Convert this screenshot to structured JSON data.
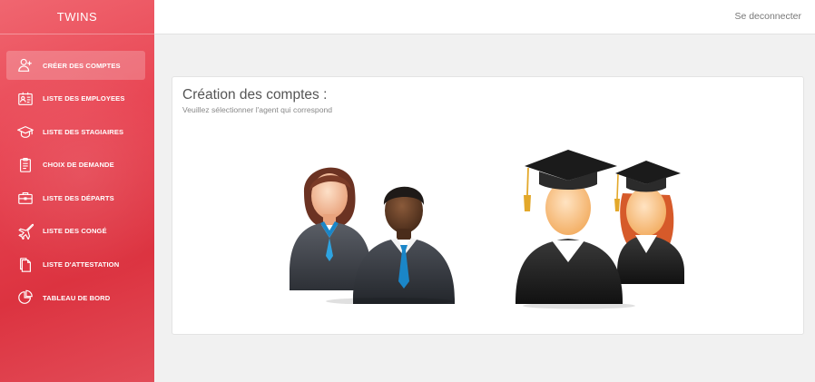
{
  "sidebar": {
    "brand": "TWINS",
    "items": [
      {
        "label": "CRÉER DES COMPTES",
        "icon": "add-user-icon",
        "active": true
      },
      {
        "label": "LISTE DES EMPLOYEES",
        "icon": "id-card-icon",
        "active": false
      },
      {
        "label": "LISTE DES STAGIAIRES",
        "icon": "graduation-cap-icon",
        "active": false
      },
      {
        "label": "CHOIX DE DEMANDE",
        "icon": "clipboard-icon",
        "active": false
      },
      {
        "label": "LISTE DES DÉPARTS",
        "icon": "briefcase-icon",
        "active": false
      },
      {
        "label": "LISTE DES CONGÉ",
        "icon": "airplane-icon",
        "active": false
      },
      {
        "label": "LISTE D'ATTESTATION",
        "icon": "documents-icon",
        "active": false
      },
      {
        "label": "TABLEAU DE BORD",
        "icon": "pie-chart-icon",
        "active": false
      }
    ]
  },
  "header": {
    "logout_label": "Se deconnecter"
  },
  "main": {
    "title": "Création des comptes :",
    "subtitle": "Veuillez sélectionner l'agent qui correspond",
    "options": [
      {
        "icon": "employees-icon"
      },
      {
        "icon": "graduates-icon"
      }
    ]
  },
  "colors": {
    "sidebar_red": "#e84553",
    "tie_blue": "#1a86c8",
    "cap_black": "#1b1b1b",
    "tassel_gold": "#e3a82a"
  }
}
